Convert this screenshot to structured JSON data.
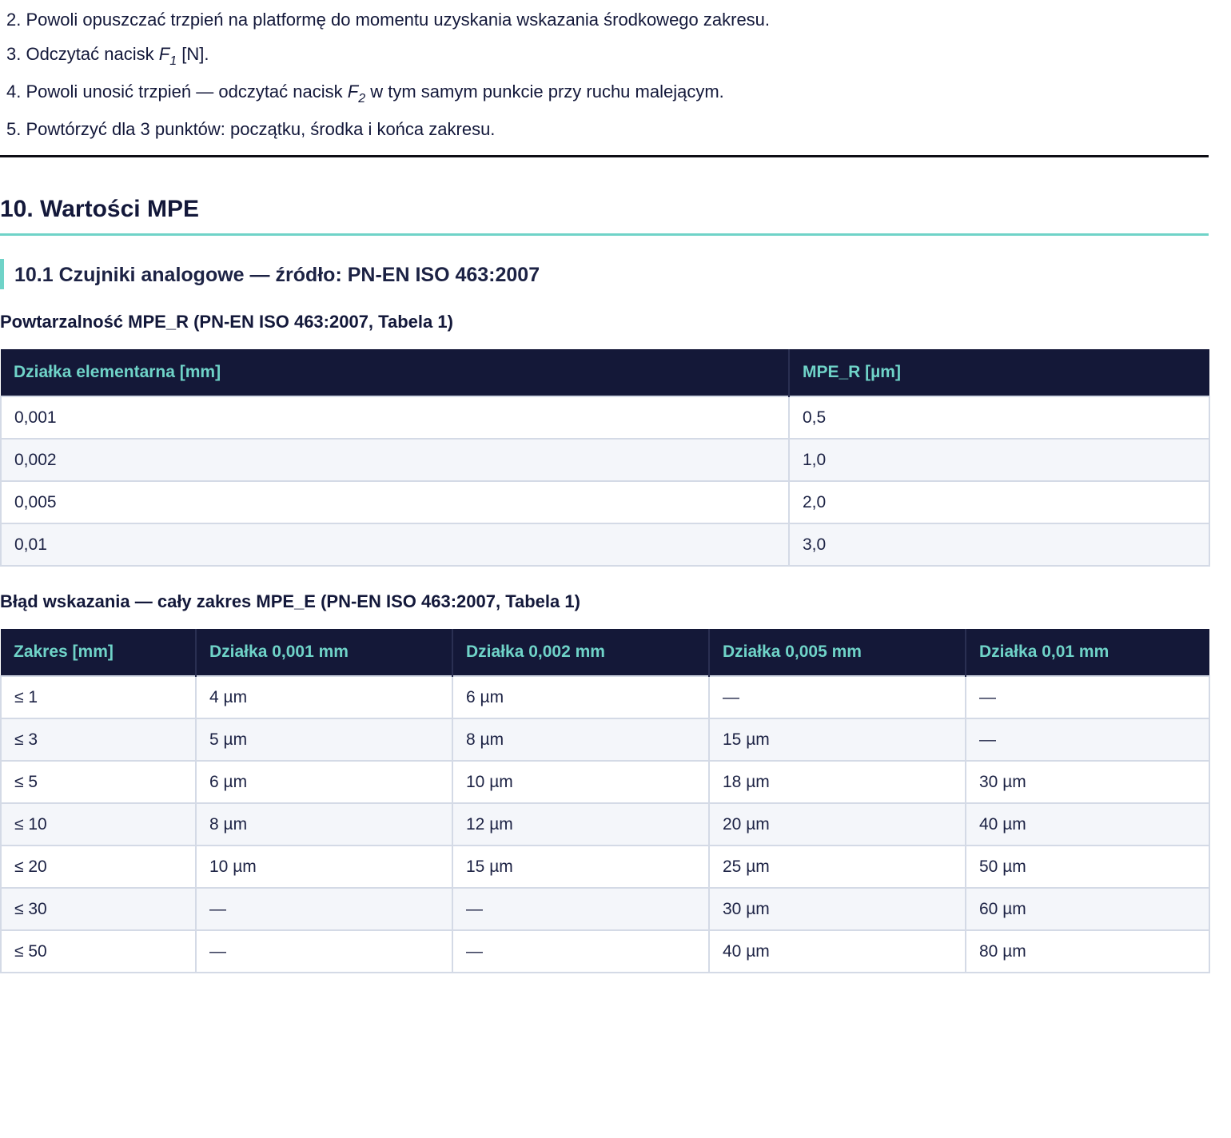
{
  "steps": [
    {
      "pre": "2. Powoli opuszczać trzpień na platformę do momentu uzyskania wskazania środkowego zakresu.",
      "var": "",
      "sub": "",
      "post": ""
    },
    {
      "pre": "3. Odczytać nacisk ",
      "var": "F",
      "sub": "1",
      "post": " [N]."
    },
    {
      "pre": "4. Powoli unosić trzpień — odczytać nacisk ",
      "var": "F",
      "sub": "2",
      "post": " w tym samym punkcie przy ruchu malejącym."
    },
    {
      "pre": "5. Powtórzyć dla 3 punktów: początku, środka i końca zakresu.",
      "var": "",
      "sub": "",
      "post": ""
    }
  ],
  "section": {
    "title": "10. Wartości MPE",
    "subsection_title": "10.1 Czujniki analogowe — źródło: PN-EN ISO 463:2007"
  },
  "table_repeatability": {
    "caption": "Powtarzalność MPE_R (PN-EN ISO 463:2007, Tabela 1)",
    "headers": [
      "Działka elementarna [mm]",
      "MPE_R [µm]"
    ],
    "rows": [
      [
        "0,001",
        "0,5"
      ],
      [
        "0,002",
        "1,0"
      ],
      [
        "0,005",
        "2,0"
      ],
      [
        "0,01",
        "3,0"
      ]
    ]
  },
  "table_error": {
    "caption": "Błąd wskazania — cały zakres MPE_E (PN-EN ISO 463:2007, Tabela 1)",
    "headers": [
      "Zakres [mm]",
      "Działka 0,001 mm",
      "Działka 0,002 mm",
      "Działka 0,005 mm",
      "Działka 0,01 mm"
    ],
    "rows": [
      [
        "≤ 1",
        "4 µm",
        "6 µm",
        "—",
        "—"
      ],
      [
        "≤ 3",
        "5 µm",
        "8 µm",
        "15 µm",
        "—"
      ],
      [
        "≤ 5",
        "6 µm",
        "10 µm",
        "18 µm",
        "30 µm"
      ],
      [
        "≤ 10",
        "8 µm",
        "12 µm",
        "20 µm",
        "40 µm"
      ],
      [
        "≤ 20",
        "10 µm",
        "15 µm",
        "25 µm",
        "50 µm"
      ],
      [
        "≤ 30",
        "—",
        "—",
        "30 µm",
        "60 µm"
      ],
      [
        "≤ 50",
        "—",
        "—",
        "40 µm",
        "80 µm"
      ]
    ]
  },
  "colors": {
    "accent": "#6fd3c8",
    "header_bg": "#141838",
    "text": "#13183a"
  }
}
